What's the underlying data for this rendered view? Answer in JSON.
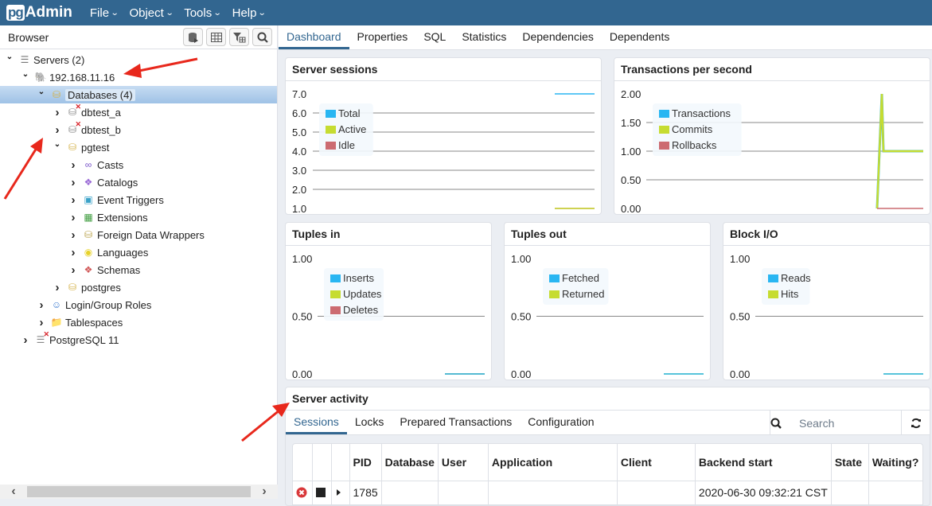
{
  "app": {
    "logo_pg": "pg",
    "logo_admin": "Admin"
  },
  "menu": [
    {
      "label": "File"
    },
    {
      "label": "Object"
    },
    {
      "label": "Tools"
    },
    {
      "label": "Help"
    }
  ],
  "browser": {
    "title": "Browser",
    "toolbar": [
      "query-tool",
      "view-data",
      "filtered-rows",
      "search-objects"
    ],
    "tree": [
      {
        "label": "Servers (2)",
        "level": 0,
        "state": "open",
        "icon": "servers-icon"
      },
      {
        "label": "192.168.11.16",
        "level": 1,
        "state": "open",
        "icon": "postgres-elephant-icon"
      },
      {
        "label": "Databases (4)",
        "level": 2,
        "state": "open",
        "icon": "databases-icon",
        "selected": true
      },
      {
        "label": "dbtest_a",
        "level": 3,
        "state": "closed",
        "icon": "database-disconnected-icon"
      },
      {
        "label": "dbtest_b",
        "level": 3,
        "state": "closed",
        "icon": "database-disconnected-icon"
      },
      {
        "label": "pgtest",
        "level": 3,
        "state": "open",
        "icon": "database-icon"
      },
      {
        "label": "Casts",
        "level": 4,
        "state": "closed",
        "icon": "casts-icon"
      },
      {
        "label": "Catalogs",
        "level": 4,
        "state": "closed",
        "icon": "catalogs-icon"
      },
      {
        "label": "Event Triggers",
        "level": 4,
        "state": "closed",
        "icon": "event-triggers-icon"
      },
      {
        "label": "Extensions",
        "level": 4,
        "state": "closed",
        "icon": "extensions-icon"
      },
      {
        "label": "Foreign Data Wrappers",
        "level": 4,
        "state": "closed",
        "icon": "foreign-data-wrappers-icon"
      },
      {
        "label": "Languages",
        "level": 4,
        "state": "closed",
        "icon": "languages-icon"
      },
      {
        "label": "Schemas",
        "level": 4,
        "state": "closed",
        "icon": "schemas-icon"
      },
      {
        "label": "postgres",
        "level": 3,
        "state": "closed",
        "icon": "database-icon"
      },
      {
        "label": "Login/Group Roles",
        "level": 2,
        "state": "closed",
        "icon": "roles-icon"
      },
      {
        "label": "Tablespaces",
        "level": 2,
        "state": "closed",
        "icon": "tablespaces-icon"
      },
      {
        "label": "PostgreSQL 11",
        "level": 1,
        "state": "closed",
        "icon": "server-disconnected-icon"
      }
    ]
  },
  "tabs": [
    {
      "label": "Dashboard",
      "active": true
    },
    {
      "label": "Properties"
    },
    {
      "label": "SQL"
    },
    {
      "label": "Statistics"
    },
    {
      "label": "Dependencies"
    },
    {
      "label": "Dependents"
    }
  ],
  "colors": {
    "blue": "#29b6f2",
    "green": "#c6dc31",
    "red": "#cc6b71",
    "accent": "#326690"
  },
  "chart_data": [
    {
      "type": "line",
      "title": "Server sessions",
      "yticks": [
        "7.0",
        "6.0",
        "5.0",
        "4.0",
        "3.0",
        "2.0",
        "1.0"
      ],
      "ylim": [
        1,
        7
      ],
      "legend": [
        "Total",
        "Active",
        "Idle"
      ],
      "legend_position": "top-left",
      "series": [
        {
          "name": "Total",
          "values": [
            7,
            7
          ]
        },
        {
          "name": "Active",
          "values": [
            1,
            1
          ]
        },
        {
          "name": "Idle",
          "values": [
            1,
            1
          ]
        }
      ]
    },
    {
      "type": "line",
      "title": "Transactions per second",
      "yticks": [
        "2.00",
        "1.50",
        "1.00",
        "0.50",
        "0.00"
      ],
      "ylim": [
        0,
        2
      ],
      "legend": [
        "Transactions",
        "Commits",
        "Rollbacks"
      ],
      "legend_position": "top-left",
      "series": [
        {
          "name": "Transactions",
          "values": [
            0,
            2,
            1,
            1,
            1
          ]
        },
        {
          "name": "Commits",
          "values": [
            0,
            2,
            1,
            1,
            1
          ]
        },
        {
          "name": "Rollbacks",
          "values": [
            0,
            0,
            0,
            0,
            0
          ]
        }
      ]
    },
    {
      "type": "line",
      "title": "Tuples in",
      "yticks": [
        "1.00",
        "0.50",
        "0.00"
      ],
      "ylim": [
        0,
        1
      ],
      "legend": [
        "Inserts",
        "Updates",
        "Deletes"
      ],
      "legend_position": "top-left",
      "series": [
        {
          "name": "Inserts",
          "values": [
            0,
            0
          ]
        },
        {
          "name": "Updates",
          "values": [
            0,
            0
          ]
        },
        {
          "name": "Deletes",
          "values": [
            0,
            0
          ]
        }
      ]
    },
    {
      "type": "line",
      "title": "Tuples out",
      "yticks": [
        "1.00",
        "0.50",
        "0.00"
      ],
      "ylim": [
        0,
        1
      ],
      "legend": [
        "Fetched",
        "Returned"
      ],
      "legend_position": "top-left",
      "series": [
        {
          "name": "Fetched",
          "values": [
            0,
            0
          ]
        },
        {
          "name": "Returned",
          "values": [
            0,
            0
          ]
        }
      ]
    },
    {
      "type": "line",
      "title": "Block I/O",
      "yticks": [
        "1.00",
        "0.50",
        "0.00"
      ],
      "ylim": [
        0,
        1
      ],
      "legend": [
        "Reads",
        "Hits"
      ],
      "legend_position": "top-left",
      "series": [
        {
          "name": "Reads",
          "values": [
            0,
            0
          ]
        },
        {
          "name": "Hits",
          "values": [
            0,
            0
          ]
        }
      ]
    }
  ],
  "activity": {
    "title": "Server activity",
    "tabs": [
      {
        "label": "Sessions",
        "active": true
      },
      {
        "label": "Locks"
      },
      {
        "label": "Prepared Transactions"
      },
      {
        "label": "Configuration"
      }
    ],
    "search_placeholder": "Search",
    "columns": [
      "",
      "",
      "",
      "PID",
      "Database",
      "User",
      "Application",
      "Client",
      "Backend start",
      "State",
      "Waiting?"
    ],
    "rows": [
      {
        "pid": "1785",
        "database": "",
        "user": "",
        "application": "",
        "client": "",
        "backend_start": "2020-06-30 09:32:21 CST",
        "state": "",
        "waiting": ""
      }
    ]
  }
}
